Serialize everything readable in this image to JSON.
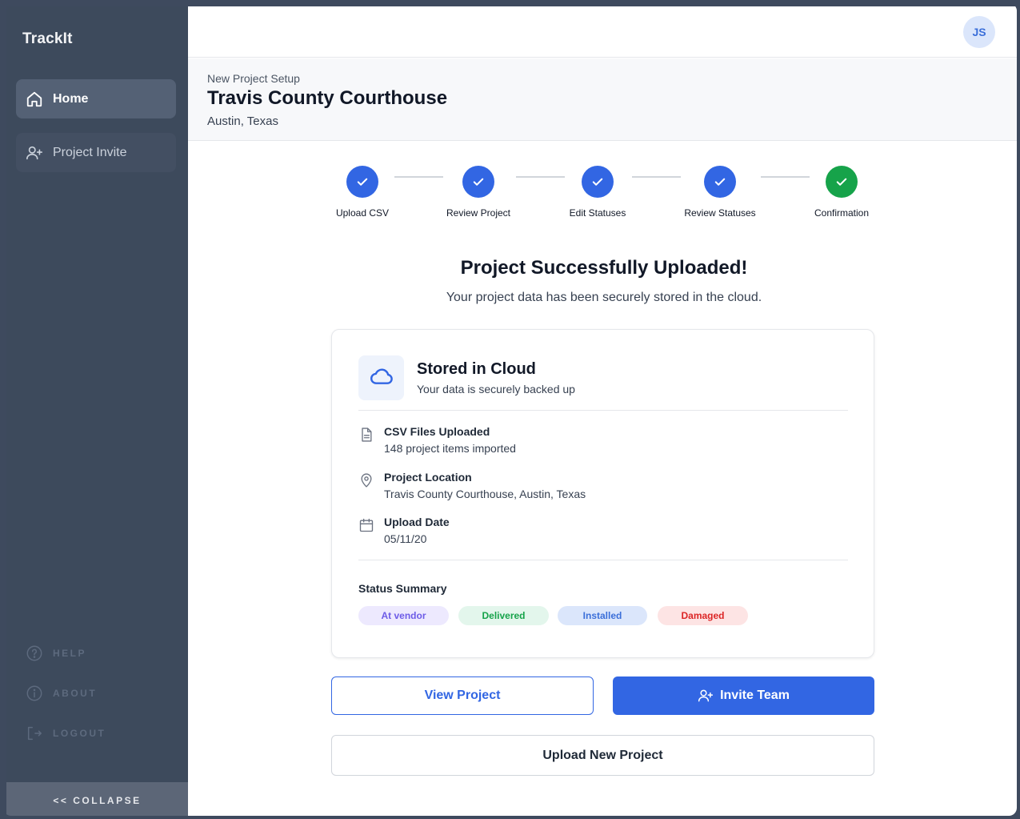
{
  "app": {
    "name": "TrackIt"
  },
  "sidebar": {
    "items": [
      {
        "label": "Home",
        "icon": "home-icon",
        "active": true
      },
      {
        "label": "Project Invite",
        "icon": "user-plus-icon",
        "active": false
      }
    ],
    "utility": [
      {
        "label": "HELP",
        "icon": "help-icon"
      },
      {
        "label": "ABOUT",
        "icon": "info-icon"
      },
      {
        "label": "LOGOUT",
        "icon": "logout-icon"
      }
    ],
    "collapse_label": "<< COLLAPSE"
  },
  "topbar": {
    "avatar_initials": "JS"
  },
  "header": {
    "crumb": "New Project Setup",
    "title": "Travis County Courthouse",
    "subtitle": "Austin, Texas"
  },
  "stepper": {
    "steps": [
      {
        "label": "Upload CSV",
        "status": "complete"
      },
      {
        "label": "Review Project",
        "status": "complete"
      },
      {
        "label": "Edit Statuses",
        "status": "complete"
      },
      {
        "label": "Review Statuses",
        "status": "complete"
      },
      {
        "label": "Confirmation",
        "status": "current-complete"
      }
    ],
    "colors": {
      "complete": "#3266e3",
      "final": "#16a34a"
    }
  },
  "success": {
    "title": "Project Successfully Uploaded!",
    "subtitle": "Your project data has been securely stored in the cloud."
  },
  "card": {
    "title": "Stored in Cloud",
    "subtitle": "Your data is securely backed up",
    "info": [
      {
        "icon": "file-icon",
        "heading": "CSV Files Uploaded",
        "value": "148 project items imported"
      },
      {
        "icon": "map-pin-icon",
        "heading": "Project Location",
        "value": "Travis County Courthouse, Austin, Texas"
      },
      {
        "icon": "calendar-icon",
        "heading": "Upload Date",
        "value": "05/11/20"
      }
    ],
    "summary_title": "Status Summary",
    "statuses": [
      {
        "label": "At vendor",
        "bg": "#ede9fe",
        "fg": "#6d5ce7"
      },
      {
        "label": "Delivered",
        "bg": "#e3f6ec",
        "fg": "#16a34a"
      },
      {
        "label": "Installed",
        "bg": "#dbe6fb",
        "fg": "#3b6fd9"
      },
      {
        "label": "Damaged",
        "bg": "#fde4e4",
        "fg": "#dc2626"
      }
    ]
  },
  "actions": {
    "view_label": "View Project",
    "invite_label": "Invite Team",
    "upload_label": "Upload New Project"
  }
}
